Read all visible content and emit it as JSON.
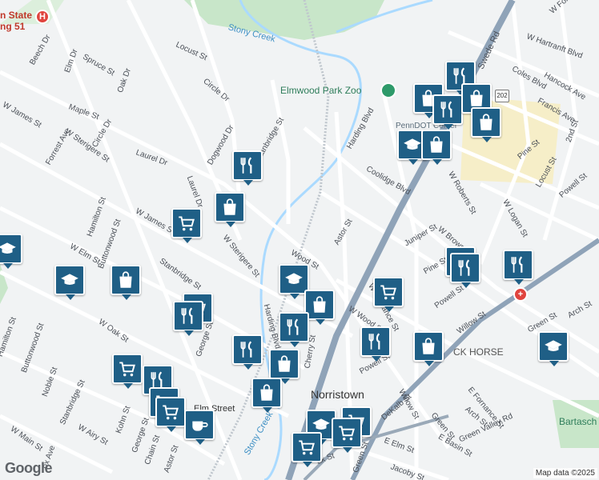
{
  "hospital_top": {
    "label": "n State\nng 51",
    "icon": "hospital-icon"
  },
  "areas": {
    "stony_creek_top": "Stony Creek",
    "stony_creek_bottom": "Stony Creek",
    "elmwood_park_zoo": "Elmwood Park Zoo",
    "penndot_center": "PennDOT Center",
    "norristown": "Norristown",
    "black_horse": "CK HORSE",
    "bartasch": "Bartasch P",
    "elm_street_station": "Elm Street"
  },
  "streets": {
    "beech": "Beech Dr",
    "elm_dr": "Elm Dr",
    "spruce": "Spruce St",
    "oak_dr": "Oak Dr",
    "locust_top": "Locust St",
    "circle_dr_top": "Circle Dr",
    "w_james_left": "W James St",
    "maple": "Maple St",
    "circle_dr": "Circle Dr",
    "w_sterigere_left": "W Sterigere St",
    "forrest": "Forrest Ave",
    "laurel_dr": "Laurel Dr",
    "laurel_dr2": "Laurel Dr",
    "dogwood": "Dogwood Dr",
    "stanbridge_top": "Stanbridge St",
    "hamilton_top": "Hamilton St",
    "w_james_mid": "W James St",
    "w_elm_left": "W Elm St",
    "buttonwood": "Buttonwood St",
    "stanbridge_mid": "Stanbridge St",
    "w_sterigere_mid": "W Sterigere St",
    "w_oak": "W Oak St",
    "hamilton_low": "Hamilton St",
    "buttonwood_low": "Buttonwood St",
    "noble": "Noble St",
    "stanbridge_low": "Stanbridge St",
    "w_main": "W Main St",
    "w_airy": "W Airy St",
    "kohn": "Kohn St",
    "george_low": "George St",
    "chain": "Chain St",
    "astor_low": "Astor St",
    "george_mid": "George St",
    "harding_blvd_low": "Harding Blvd",
    "wood_st": "Wood St",
    "cherry": "Cherry St",
    "astor_mid": "Astor St",
    "harding_blvd_top": "Harding Blvd",
    "coolidge": "Coolidge Blvd",
    "juniper": "Juniper St",
    "w_fornance": "W Fornance St",
    "pine_low": "Pine St",
    "w_wood": "W Wood St",
    "powell_low": "Powell St",
    "willow_low": "Willow St",
    "dekalb": "DeKalb St",
    "green_low": "Green St",
    "e_basin": "E Basin St",
    "e_elm": "E Elm St",
    "jacoby": "Jacoby St",
    "green_valley": "Green Valley Rd",
    "e_fornance": "E Fornance St",
    "arch_low": "Arch St",
    "willow_mid": "Willow St",
    "powell_mid": "Powell St",
    "w_brown": "W Brown St",
    "w_roberts": "W Roberts St",
    "w_logan": "W Logan St",
    "pine_right": "Pine St",
    "locust_right": "Locust St",
    "powell_right": "Powell St",
    "second": "2nd St",
    "francis": "Francis Ave",
    "hancock": "Hancock Ave",
    "coles": "Coles Blvd",
    "w_hartranft": "W Hartranft Blvd",
    "w_fornance_top": "W Fornance St",
    "swede_rd": "Swede Rd",
    "green_right": "Green St",
    "arch_right": "Arch St",
    "route_202": "202",
    "box_ave": "ox Ave",
    "bak_st": "ak St",
    "green_st_l": "Green St"
  },
  "pins": [
    {
      "type": "restaurant",
      "icon": "fork-knife-icon"
    },
    {
      "type": "shopping",
      "icon": "shopping-bag-icon"
    },
    {
      "type": "grocery",
      "icon": "shopping-cart-icon"
    },
    {
      "type": "school",
      "icon": "graduation-cap-icon"
    },
    {
      "type": "cafe",
      "icon": "coffee-cup-icon"
    }
  ],
  "footer": {
    "google": "Google",
    "attribution": "Map data ©2025"
  },
  "colors": {
    "pin": "#1f5f86",
    "highway": "#8fa3b8",
    "park": "#c8e6c9",
    "water": "#aadaff"
  }
}
